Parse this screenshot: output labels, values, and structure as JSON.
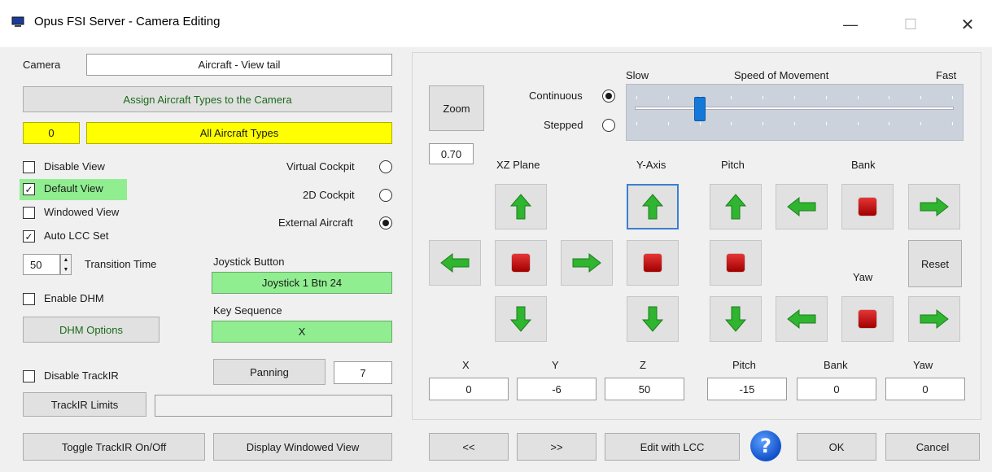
{
  "window": {
    "title": "Opus FSI Server - Camera Editing",
    "minimize_glyph": "—",
    "maximize_glyph": "☐",
    "close_glyph": "✕"
  },
  "left": {
    "camera_label": "Camera",
    "camera_value": "Aircraft - View tail",
    "assign_button": "Assign Aircraft Types to the Camera",
    "type_count": "0",
    "type_value": "All Aircraft Types",
    "disable_view": {
      "label": "Disable View",
      "checked": false
    },
    "default_view": {
      "label": "Default View",
      "checked": true
    },
    "windowed_view": {
      "label": "Windowed View",
      "checked": false
    },
    "auto_lcc": {
      "label": "Auto LCC Set",
      "checked": true
    },
    "transition_value": "50",
    "transition_label": "Transition Time",
    "enable_dhm": {
      "label": "Enable DHM",
      "checked": false
    },
    "dhm_options_button": "DHM Options",
    "disable_trackir": {
      "label": "Disable TrackIR",
      "checked": false
    },
    "trackir_limits_button": "TrackIR Limits",
    "trackir_limits_value": "",
    "toggle_trackir_button": "Toggle TrackIR On/Off",
    "display_windowed_button": "Display Windowed View"
  },
  "middle": {
    "virtual_cockpit": {
      "label": "Virtual Cockpit",
      "selected": false
    },
    "cockpit_2d": {
      "label": "2D Cockpit",
      "selected": false
    },
    "external_aircraft": {
      "label": "External Aircraft",
      "selected": true
    },
    "joystick_label": "Joystick Button",
    "joystick_value": "Joystick 1 Btn 24",
    "key_label": "Key Sequence",
    "key_value": "X",
    "panning_button": "Panning",
    "panning_value": "7"
  },
  "right": {
    "zoom_button": "Zoom",
    "zoom_value": "0.70",
    "continuous": {
      "label": "Continuous",
      "selected": true
    },
    "stepped": {
      "label": "Stepped",
      "selected": false
    },
    "speed": {
      "slow": "Slow",
      "title": "Speed of Movement",
      "fast": "Fast",
      "value_fraction": 0.2
    },
    "headers": {
      "xz_plane": "XZ Plane",
      "y_axis": "Y-Axis",
      "pitch": "Pitch",
      "bank": "Bank",
      "yaw": "Yaw"
    },
    "reset_button": "Reset",
    "coords": {
      "x_label": "X",
      "x_value": "0",
      "y_label": "Y",
      "y_value": "-6",
      "z_label": "Z",
      "z_value": "50",
      "pitch_label": "Pitch",
      "pitch_value": "-15",
      "bank_label": "Bank",
      "bank_value": "0",
      "yaw_label": "Yaw",
      "yaw_value": "0"
    },
    "prev_button": "<<",
    "next_button": ">>",
    "edit_lcc_button": "Edit with LCC",
    "help_glyph": "?",
    "ok_button": "OK",
    "cancel_button": "Cancel"
  },
  "colors": {
    "highlight_yellow": "#ffff00",
    "highlight_green": "#90ee90",
    "arrow_green": "#2fb52f",
    "stop_red": "#c81010",
    "selected_border": "#3c7fd0"
  }
}
